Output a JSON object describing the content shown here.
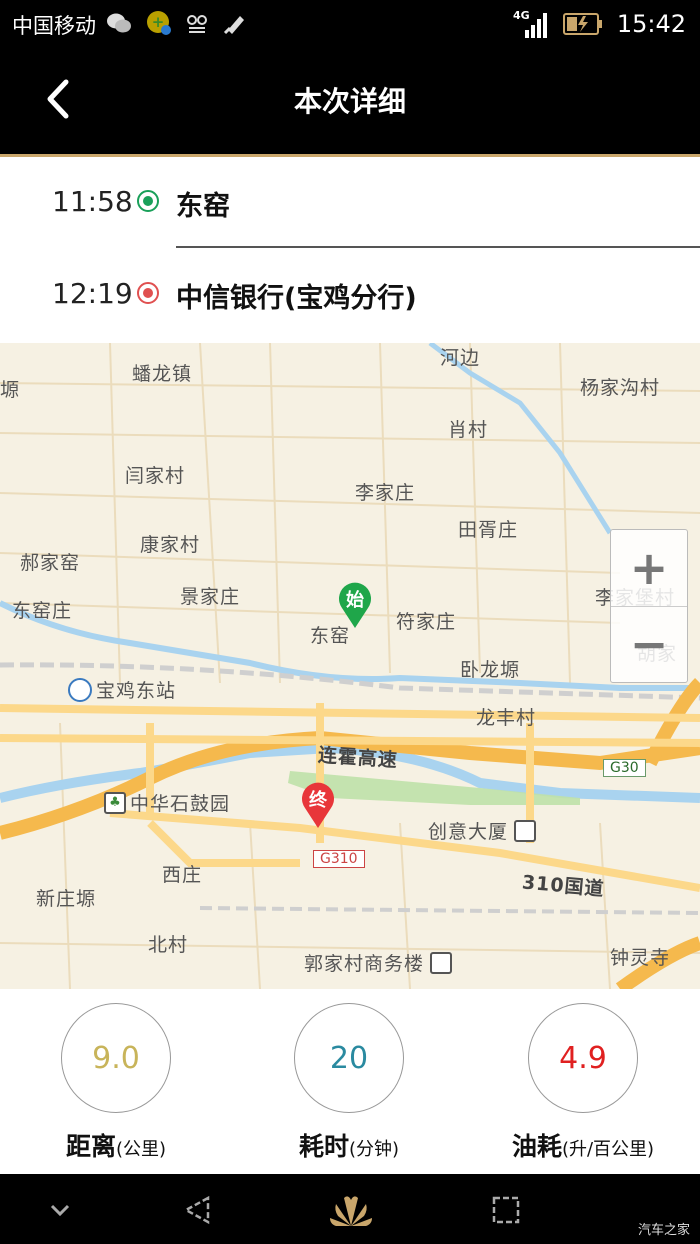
{
  "status_bar": {
    "carrier": "中国移动",
    "network": "4G",
    "time": "15:42",
    "icons": [
      "wechat-icon",
      "app-badge-icon",
      "voicemail-icon",
      "usb-icon",
      "signal-icon",
      "battery-charging-icon"
    ]
  },
  "header": {
    "title": "本次详细",
    "back_icon": "chevron-left-icon"
  },
  "route": {
    "start": {
      "time": "11:58",
      "place": "东窑",
      "color": "#1aa05a"
    },
    "end": {
      "time": "12:19",
      "place": "中信银行(宝鸡分行)",
      "color": "#e05050"
    }
  },
  "map": {
    "labels": [
      "河边",
      "蟠龙镇",
      "杨家沟村",
      "塬",
      "肖村",
      "闫家村",
      "李家庄",
      "田胥庄",
      "康家村",
      "郝家窑",
      "景家庄",
      "李家堡村",
      "东窑庄",
      "东窑",
      "符家庄",
      "胡家",
      "卧龙塬",
      "宝鸡东站",
      "龙丰村",
      "连霍高速",
      "G30",
      "中华石鼓园",
      "创意大厦",
      "西庄",
      "G310",
      "310国道",
      "新庄塬",
      "北村",
      "郭家村商务楼",
      "钟灵寺"
    ],
    "start_pin": "始",
    "end_pin": "终",
    "zoom_in": "+",
    "zoom_out": "−"
  },
  "stats": {
    "distance": {
      "value": "9.0",
      "label": "距离",
      "unit": "(公里)",
      "color": "#c8b45a"
    },
    "duration": {
      "value": "20",
      "label": "耗时",
      "unit": "(分钟)",
      "color": "#2a8aa0"
    },
    "fuel": {
      "value": "4.9",
      "label": "油耗",
      "unit": "(升/百公里)",
      "color": "#e02020"
    }
  },
  "nav_bar": {
    "icons": [
      "hide-icon",
      "back-nav-icon",
      "huawei-home-icon",
      "recents-icon"
    ]
  },
  "watermark": "汽车之家"
}
